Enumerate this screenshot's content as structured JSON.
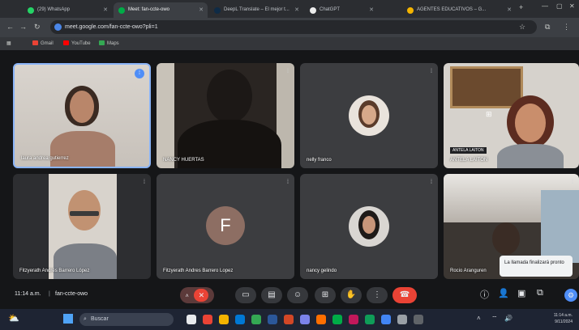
{
  "browser": {
    "tabs": [
      {
        "label": "(29) WhatsApp",
        "favicon_color": "#25d366",
        "active": false
      },
      {
        "label": "Meet: fan-ccte-owo",
        "favicon_color": "#00ac47",
        "active": true
      },
      {
        "label": "DeepL Translate – El mejor t...",
        "favicon_color": "#0f2b46",
        "active": false
      },
      {
        "label": "ChatGPT",
        "favicon_color": "#ececec",
        "active": false
      },
      {
        "label": "AGENTES EDUCATIVOS – G...",
        "favicon_color": "#f4b400",
        "active": false
      }
    ],
    "url": "meet.google.com/fan-ccte-owo?pli=1",
    "bookmarks": [
      {
        "label": "Gmail",
        "color": "#ea4335"
      },
      {
        "label": "YouTube",
        "color": "#ff0000"
      },
      {
        "label": "Maps",
        "color": "#34a853"
      }
    ]
  },
  "participants": [
    {
      "name": "laura andrea gutierrez",
      "type": "video",
      "speaking": true
    },
    {
      "name": "NANCY HUERTAS",
      "type": "video",
      "speaking": false
    },
    {
      "name": "nelly franco",
      "type": "avatar",
      "speaking": false
    },
    {
      "name": "ANTELA LAITON",
      "type": "video",
      "speaking": false,
      "overlay_label": "ANTELA LAITON"
    },
    {
      "name": "Fitzyerath Andrés Barrero López",
      "type": "video",
      "speaking": false
    },
    {
      "name": "Fitzyerath Andres Barrero Lopez",
      "type": "letter",
      "letter": "F",
      "speaking": false
    },
    {
      "name": "nancy gelindo",
      "type": "avatar",
      "speaking": false
    },
    {
      "name": "Rocio Aranguren",
      "type": "video",
      "speaking": false
    }
  ],
  "meeting": {
    "time": "11:14 a.m.",
    "code": "fan-ccte-owo",
    "controls": [
      {
        "icon": "mic-off-icon",
        "glyph": "🎙"
      },
      {
        "icon": "camera-icon",
        "glyph": "▭"
      },
      {
        "icon": "captions-icon",
        "glyph": "▤"
      },
      {
        "icon": "emoji-icon",
        "glyph": "☺"
      },
      {
        "icon": "present-icon",
        "glyph": "⊞"
      },
      {
        "icon": "raise-hand-icon",
        "glyph": "✋"
      },
      {
        "icon": "more-options-icon",
        "glyph": "⋮"
      }
    ],
    "end_call_glyph": "☎",
    "toast": "La llamada finalizará pronto"
  },
  "taskbar": {
    "search_placeholder": "Buscar",
    "time": "11:14 a.m.",
    "date": "9/11/2024"
  },
  "colors": {
    "speaking_border": "#8ab4f8",
    "end_call": "#ea4335",
    "letter_avatar": "#8d6e63"
  }
}
